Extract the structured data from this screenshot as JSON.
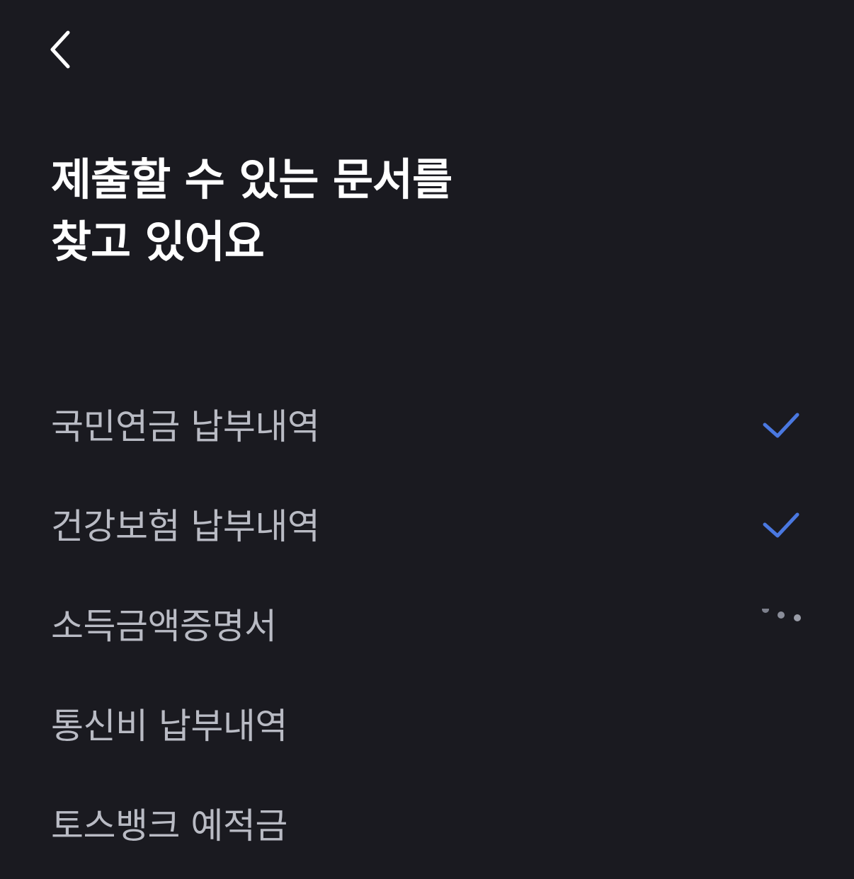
{
  "header": {
    "back_icon": "chevron-left-icon"
  },
  "title": {
    "line1": "제출할 수 있는 문서를",
    "line2": "찾고 있어요"
  },
  "documents": [
    {
      "label": "국민연금 납부내역",
      "status": "done",
      "status_icon": "checkmark-icon"
    },
    {
      "label": "건강보험 납부내역",
      "status": "done",
      "status_icon": "checkmark-icon"
    },
    {
      "label": "소득금액증명서",
      "status": "loading",
      "status_icon": "loading-dots-icon"
    },
    {
      "label": "통신비 납부내역",
      "status": "pending"
    },
    {
      "label": "토스뱅크 예적금",
      "status": "pending"
    }
  ],
  "colors": {
    "background": "#1a1a20",
    "title": "#ffffff",
    "item_text": "#b9bbc4",
    "check": "#4a78e0",
    "loading_dots": "#8a8d99"
  }
}
